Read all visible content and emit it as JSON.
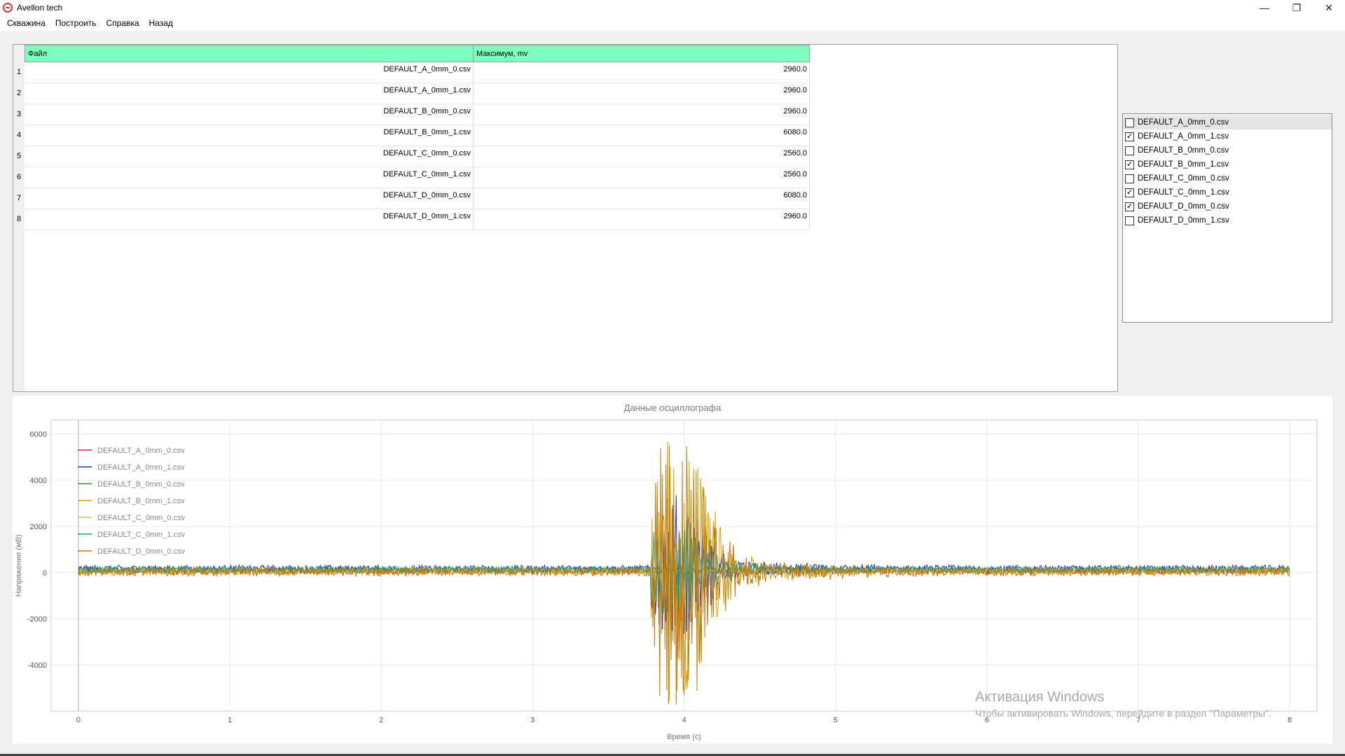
{
  "window": {
    "title": "Avellon tech",
    "controls": {
      "minimize": "—",
      "restore": "❐",
      "close": "✕"
    }
  },
  "menu": [
    {
      "label": "Скважина"
    },
    {
      "label": "Построить"
    },
    {
      "label": "Справка"
    },
    {
      "label": "Назад"
    }
  ],
  "table": {
    "headers": [
      "Файл",
      "Максимум, mv"
    ],
    "rows": [
      {
        "num": "1",
        "file": "DEFAULT_A_0mm_0.csv",
        "max": "2960.0"
      },
      {
        "num": "2",
        "file": "DEFAULT_A_0mm_1.csv",
        "max": "2960.0"
      },
      {
        "num": "3",
        "file": "DEFAULT_B_0mm_0.csv",
        "max": "2960.0"
      },
      {
        "num": "4",
        "file": "DEFAULT_B_0mm_1.csv",
        "max": "6080.0"
      },
      {
        "num": "5",
        "file": "DEFAULT_C_0mm_0.csv",
        "max": "2560.0"
      },
      {
        "num": "6",
        "file": "DEFAULT_C_0mm_1.csv",
        "max": "2560.0"
      },
      {
        "num": "7",
        "file": "DEFAULT_D_0mm_0.csv",
        "max": "6080.0"
      },
      {
        "num": "8",
        "file": "DEFAULT_D_0mm_1.csv",
        "max": "2960.0"
      }
    ]
  },
  "file_list": [
    {
      "label": "DEFAULT_A_0mm_0.csv",
      "checked": false,
      "selected": true
    },
    {
      "label": "DEFAULT_A_0mm_1.csv",
      "checked": true,
      "selected": false
    },
    {
      "label": "DEFAULT_B_0mm_0.csv",
      "checked": false,
      "selected": false
    },
    {
      "label": "DEFAULT_B_0mm_1.csv",
      "checked": true,
      "selected": false
    },
    {
      "label": "DEFAULT_C_0mm_0.csv",
      "checked": false,
      "selected": false
    },
    {
      "label": "DEFAULT_C_0mm_1.csv",
      "checked": true,
      "selected": false
    },
    {
      "label": "DEFAULT_D_0mm_0.csv",
      "checked": true,
      "selected": false
    },
    {
      "label": "DEFAULT_D_0mm_1.csv",
      "checked": false,
      "selected": false
    }
  ],
  "chart_data": {
    "type": "line",
    "title": "Данные осциллографа",
    "xlabel": "Время (с)",
    "ylabel": "Напряжение (мВ)",
    "xlim": [
      -0.18,
      8.18
    ],
    "ylim": [
      -6000,
      6600
    ],
    "xticks": [
      "0",
      "1",
      "2",
      "3",
      "4",
      "5",
      "6",
      "7",
      "8"
    ],
    "yticks": [
      "6000",
      "4000",
      "2000",
      "0",
      "-2000",
      "-4000"
    ],
    "grid": true,
    "legend_position": "top-left",
    "series": [
      {
        "name": "DEFAULT_A_0mm_0.csv",
        "color": "#e0202a",
        "noise": 150,
        "offset": 80,
        "burst": 0
      },
      {
        "name": "DEFAULT_A_0mm_1.csv",
        "color": "#2030d0",
        "noise": 160,
        "offset": 160,
        "burst": 2600
      },
      {
        "name": "DEFAULT_B_0mm_0.csv",
        "color": "#2a9a2a",
        "noise": 120,
        "offset": 100,
        "burst": 0
      },
      {
        "name": "DEFAULT_B_0mm_1.csv",
        "color": "#d8a000",
        "noise": 170,
        "offset": 60,
        "burst": 5000
      },
      {
        "name": "DEFAULT_C_0mm_0.csv",
        "color": "#d8b860",
        "noise": 110,
        "offset": 90,
        "burst": 0
      },
      {
        "name": "DEFAULT_C_0mm_1.csv",
        "color": "#1a9a8a",
        "noise": 140,
        "offset": 140,
        "burst": 1800
      },
      {
        "name": "DEFAULT_D_0mm_0.csv",
        "color": "#c07a10",
        "noise": 180,
        "offset": 30,
        "burst": 5500
      }
    ],
    "burst_start_s": 3.78,
    "burst_peak_s": 3.98
  },
  "watermark": {
    "title": "Активация Windows",
    "subtitle": "Чтобы активировать Windows, перейдите в раздел \"Параметры\"."
  }
}
